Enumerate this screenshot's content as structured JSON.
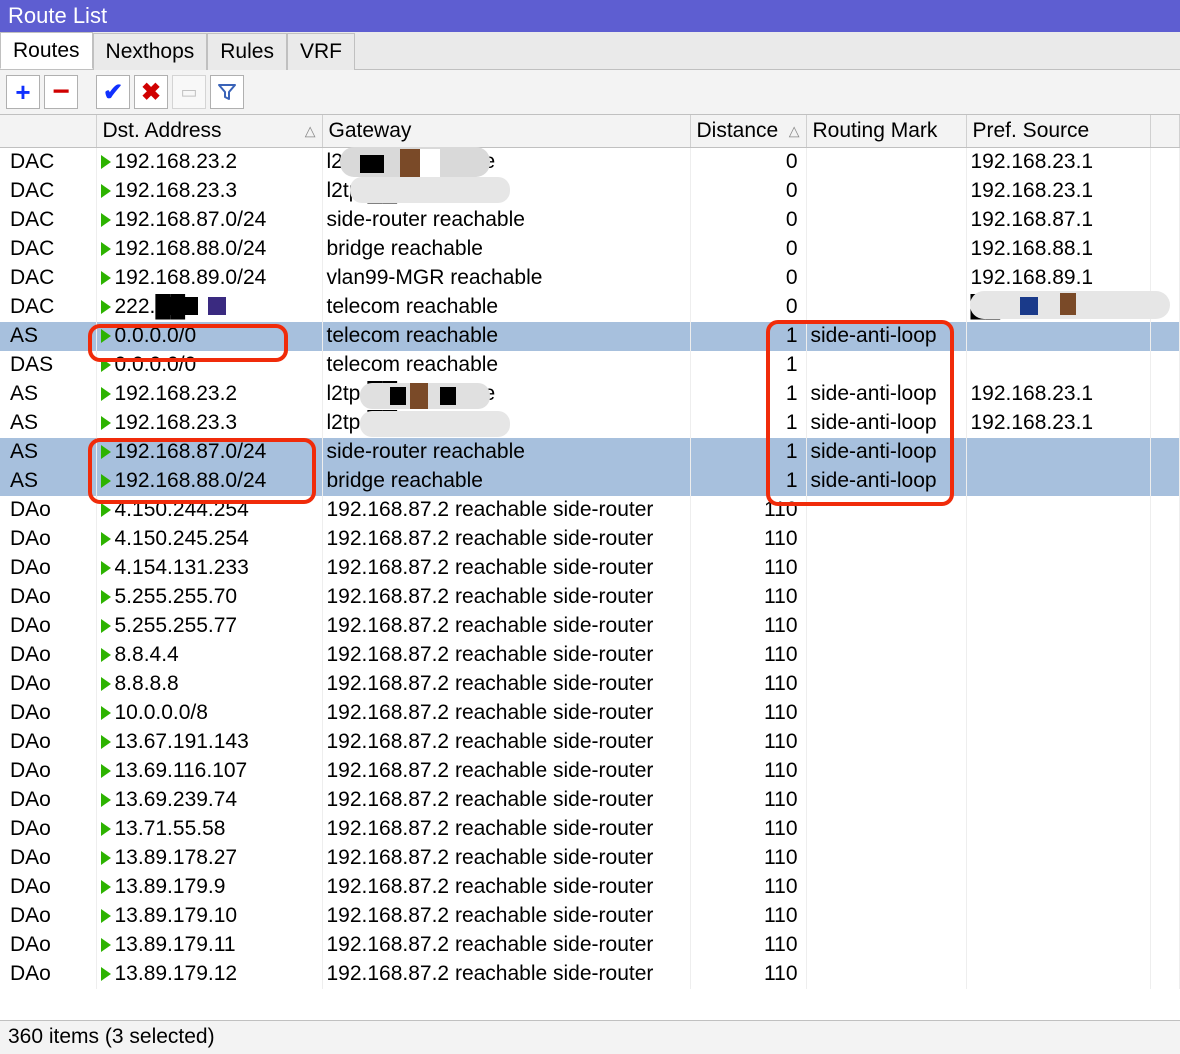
{
  "window_title": "Route List",
  "tabs": [
    {
      "label": "Routes",
      "active": true
    },
    {
      "label": "Nexthops",
      "active": false
    },
    {
      "label": "Rules",
      "active": false
    },
    {
      "label": "VRF",
      "active": false
    }
  ],
  "toolbar": {
    "add": "+",
    "remove": "−",
    "enable": "✔",
    "disable": "✖",
    "comment": "…",
    "filter": "filter"
  },
  "columns": [
    {
      "key": "flags",
      "label": ""
    },
    {
      "key": "dst",
      "label": "Dst. Address",
      "sort": "asc"
    },
    {
      "key": "gateway",
      "label": "Gateway"
    },
    {
      "key": "distance",
      "label": "Distance",
      "sort": "asc"
    },
    {
      "key": "mark",
      "label": "Routing Mark"
    },
    {
      "key": "src",
      "label": "Pref. Source"
    }
  ],
  "rows": [
    {
      "flags": "DAC",
      "dst": "192.168.23.2",
      "gateway": "l2tp-██ reachable",
      "distance": 0,
      "mark": "",
      "src": "192.168.23.1",
      "selected": false
    },
    {
      "flags": "DAC",
      "dst": "192.168.23.3",
      "gateway": "l2tp-██ reachable",
      "distance": 0,
      "mark": "",
      "src": "192.168.23.1",
      "selected": false
    },
    {
      "flags": "DAC",
      "dst": "192.168.87.0/24",
      "gateway": "side-router reachable",
      "distance": 0,
      "mark": "",
      "src": "192.168.87.1",
      "selected": false
    },
    {
      "flags": "DAC",
      "dst": "192.168.88.0/24",
      "gateway": "bridge reachable",
      "distance": 0,
      "mark": "",
      "src": "192.168.88.1",
      "selected": false
    },
    {
      "flags": "DAC",
      "dst": "192.168.89.0/24",
      "gateway": "vlan99-MGR reachable",
      "distance": 0,
      "mark": "",
      "src": "192.168.89.1",
      "selected": false
    },
    {
      "flags": "DAC",
      "dst": "222.██",
      "gateway": "telecom reachable",
      "distance": 0,
      "mark": "",
      "src": "██",
      "selected": false
    },
    {
      "flags": "AS",
      "dst": "0.0.0.0/0",
      "gateway": "telecom reachable",
      "distance": 1,
      "mark": "side-anti-loop",
      "src": "",
      "selected": true
    },
    {
      "flags": "DAS",
      "dst": "0.0.0.0/0",
      "gateway": "telecom reachable",
      "distance": 1,
      "mark": "",
      "src": "",
      "selected": false
    },
    {
      "flags": "AS",
      "dst": "192.168.23.2",
      "gateway": "l2tp-██ reachable",
      "distance": 1,
      "mark": "side-anti-loop",
      "src": "192.168.23.1",
      "selected": false
    },
    {
      "flags": "AS",
      "dst": "192.168.23.3",
      "gateway": "l2tp-██ reachable",
      "distance": 1,
      "mark": "side-anti-loop",
      "src": "192.168.23.1",
      "selected": false
    },
    {
      "flags": "AS",
      "dst": "192.168.87.0/24",
      "gateway": "side-router reachable",
      "distance": 1,
      "mark": "side-anti-loop",
      "src": "",
      "selected": true
    },
    {
      "flags": "AS",
      "dst": "192.168.88.0/24",
      "gateway": "bridge reachable",
      "distance": 1,
      "mark": "side-anti-loop",
      "src": "",
      "selected": true
    },
    {
      "flags": "DAo",
      "dst": "4.150.244.254",
      "gateway": "192.168.87.2 reachable side-router",
      "distance": 110,
      "mark": "",
      "src": "",
      "selected": false
    },
    {
      "flags": "DAo",
      "dst": "4.150.245.254",
      "gateway": "192.168.87.2 reachable side-router",
      "distance": 110,
      "mark": "",
      "src": "",
      "selected": false
    },
    {
      "flags": "DAo",
      "dst": "4.154.131.233",
      "gateway": "192.168.87.2 reachable side-router",
      "distance": 110,
      "mark": "",
      "src": "",
      "selected": false
    },
    {
      "flags": "DAo",
      "dst": "5.255.255.70",
      "gateway": "192.168.87.2 reachable side-router",
      "distance": 110,
      "mark": "",
      "src": "",
      "selected": false
    },
    {
      "flags": "DAo",
      "dst": "5.255.255.77",
      "gateway": "192.168.87.2 reachable side-router",
      "distance": 110,
      "mark": "",
      "src": "",
      "selected": false
    },
    {
      "flags": "DAo",
      "dst": "8.8.4.4",
      "gateway": "192.168.87.2 reachable side-router",
      "distance": 110,
      "mark": "",
      "src": "",
      "selected": false
    },
    {
      "flags": "DAo",
      "dst": "8.8.8.8",
      "gateway": "192.168.87.2 reachable side-router",
      "distance": 110,
      "mark": "",
      "src": "",
      "selected": false
    },
    {
      "flags": "DAo",
      "dst": "10.0.0.0/8",
      "gateway": "192.168.87.2 reachable side-router",
      "distance": 110,
      "mark": "",
      "src": "",
      "selected": false
    },
    {
      "flags": "DAo",
      "dst": "13.67.191.143",
      "gateway": "192.168.87.2 reachable side-router",
      "distance": 110,
      "mark": "",
      "src": "",
      "selected": false
    },
    {
      "flags": "DAo",
      "dst": "13.69.116.107",
      "gateway": "192.168.87.2 reachable side-router",
      "distance": 110,
      "mark": "",
      "src": "",
      "selected": false
    },
    {
      "flags": "DAo",
      "dst": "13.69.239.74",
      "gateway": "192.168.87.2 reachable side-router",
      "distance": 110,
      "mark": "",
      "src": "",
      "selected": false
    },
    {
      "flags": "DAo",
      "dst": "13.71.55.58",
      "gateway": "192.168.87.2 reachable side-router",
      "distance": 110,
      "mark": "",
      "src": "",
      "selected": false
    },
    {
      "flags": "DAo",
      "dst": "13.89.178.27",
      "gateway": "192.168.87.2 reachable side-router",
      "distance": 110,
      "mark": "",
      "src": "",
      "selected": false
    },
    {
      "flags": "DAo",
      "dst": "13.89.179.9",
      "gateway": "192.168.87.2 reachable side-router",
      "distance": 110,
      "mark": "",
      "src": "",
      "selected": false
    },
    {
      "flags": "DAo",
      "dst": "13.89.179.10",
      "gateway": "192.168.87.2 reachable side-router",
      "distance": 110,
      "mark": "",
      "src": "",
      "selected": false
    },
    {
      "flags": "DAo",
      "dst": "13.89.179.11",
      "gateway": "192.168.87.2 reachable side-router",
      "distance": 110,
      "mark": "",
      "src": "",
      "selected": false
    },
    {
      "flags": "DAo",
      "dst": "13.89.179.12",
      "gateway": "192.168.87.2 reachable side-router",
      "distance": 110,
      "mark": "",
      "src": "",
      "selected": false
    }
  ],
  "status": "360 items (3 selected)"
}
